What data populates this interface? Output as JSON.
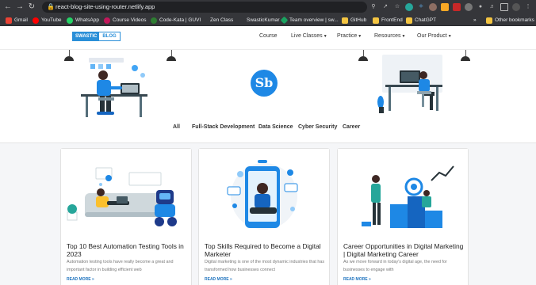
{
  "browser": {
    "url": "react-blog-site-using-router.netlify.app",
    "bookmarks": [
      {
        "label": "Gmail",
        "color": "#ea4335"
      },
      {
        "label": "YouTube",
        "color": "#ff0000"
      },
      {
        "label": "WhatsApp",
        "color": "#25d366"
      },
      {
        "label": "Course Videos",
        "color": "#c2185b"
      },
      {
        "label": "Code-Kata | GUVI",
        "color": "#2e7d32"
      },
      {
        "label": "Zen Class",
        "color": "#444444"
      },
      {
        "label": "SwasticKumar",
        "color": "#333333"
      },
      {
        "label": "Team overview | sw...",
        "color": "#1aa260"
      },
      {
        "label": "GitHub",
        "color": "#f4c542"
      },
      {
        "label": "FrontEnd",
        "color": "#f4c542"
      },
      {
        "label": "ChatGPT",
        "color": "#f4c542"
      }
    ],
    "other_bookmarks": "Other bookmarks",
    "more_chevron": "»"
  },
  "site": {
    "logo_left": "SWASTIC",
    "logo_right": "BLOG",
    "menu": [
      {
        "label": "Course",
        "has_caret": false
      },
      {
        "label": "Live Classes",
        "has_caret": true
      },
      {
        "label": "Practice",
        "has_caret": true
      },
      {
        "label": "Resources",
        "has_caret": true
      },
      {
        "label": "Our Product",
        "has_caret": true
      }
    ],
    "center_logo_text": "Sb",
    "categories": [
      "All",
      "Full-Stack Development",
      "Data Science",
      "Cyber Security",
      "Career"
    ]
  },
  "cards": [
    {
      "title": "Top 10 Best Automation Testing Tools in 2023",
      "excerpt": "Automation testing tools have really become a great and important factor in building efficient web",
      "more": "READ MORE »"
    },
    {
      "title": "Top Skills Required to Become a Digital Marketer",
      "excerpt": "Digital marketing is one of the most dynamic industries that has transformed how businesses connect",
      "more": "READ MORE »"
    },
    {
      "title": "Career Opportunities in Digital Marketing | Digital Marketing Career",
      "excerpt": "As we move forward in today's digital age, the need for businesses to engage with",
      "more": "READ MORE »"
    }
  ],
  "colors": {
    "brand": "#1e88e5",
    "link": "#1e73be",
    "chrome": "#35363a"
  }
}
